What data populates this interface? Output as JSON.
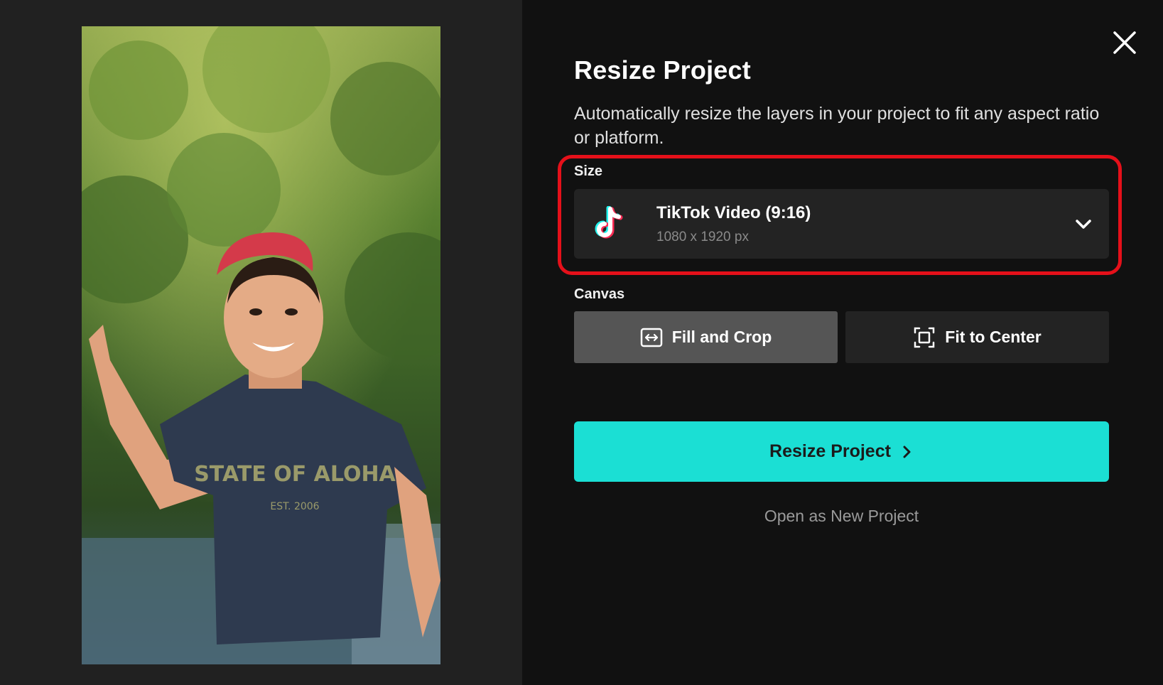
{
  "dialog": {
    "title": "Resize Project",
    "description": "Automatically resize the layers in your project to fit any aspect ratio or platform."
  },
  "preview": {
    "shirt_text": "STATE OF ALOHA",
    "shirt_subtext": "EST. 2006"
  },
  "size": {
    "label": "Size",
    "selected_name": "TikTok Video (9:16)",
    "selected_dimensions": "1080 x 1920 px",
    "icon": "tiktok-icon",
    "highlight_color": "#e5101a"
  },
  "canvas": {
    "label": "Canvas",
    "options": [
      {
        "label": "Fill and Crop",
        "icon": "fill-crop-icon",
        "active": true
      },
      {
        "label": "Fit to Center",
        "icon": "fit-center-icon",
        "active": false
      }
    ]
  },
  "actions": {
    "primary_label": "Resize Project",
    "secondary_label": "Open as New Project"
  },
  "colors": {
    "accent": "#1bdfd4",
    "panel_bg": "#111111",
    "preview_bg": "#212121",
    "control_bg": "#232323",
    "active_option_bg": "#555555"
  }
}
